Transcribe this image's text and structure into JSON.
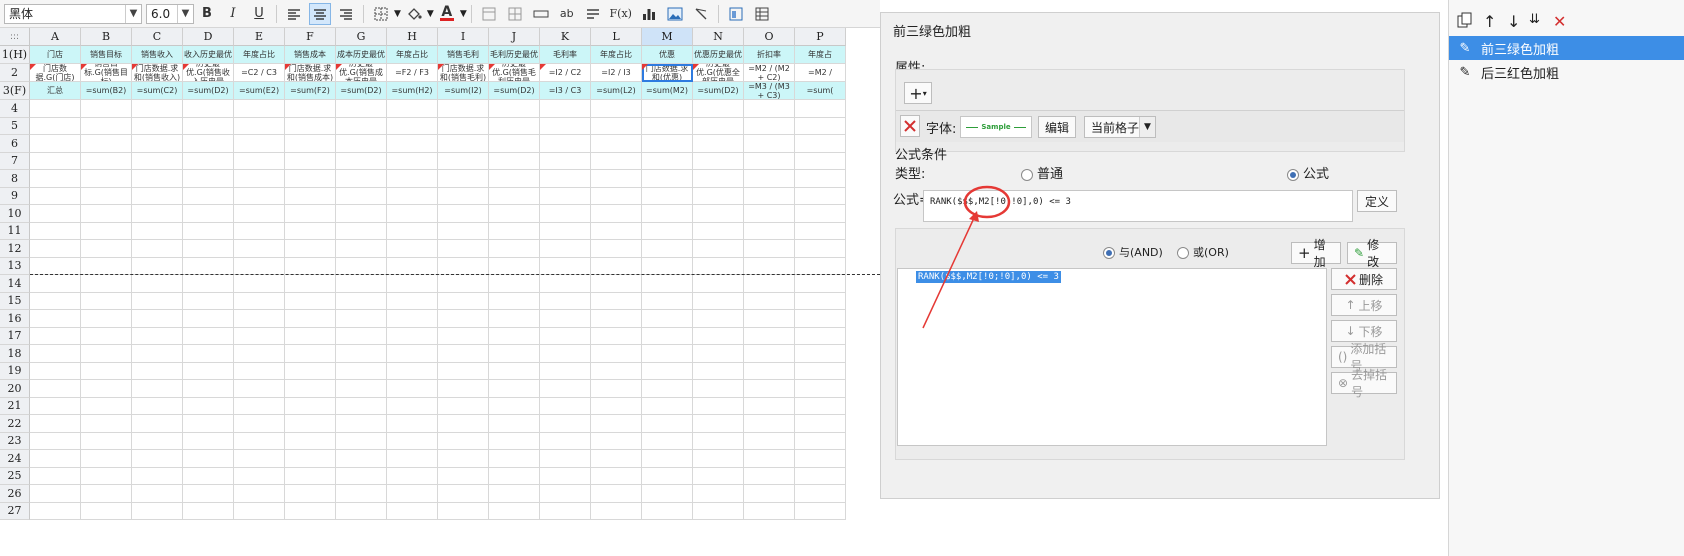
{
  "toolbar": {
    "font_name": "黑体",
    "font_size": "6.0",
    "bold": "B",
    "italic": "I",
    "underline": "U",
    "font_color_letter": "A",
    "fx": "F(x)",
    "ab": "ab"
  },
  "sheet": {
    "corner": ":::",
    "columns": [
      "A",
      "B",
      "C",
      "D",
      "E",
      "F",
      "G",
      "H",
      "I",
      "J",
      "K",
      "L",
      "M",
      "N",
      "O",
      "P"
    ],
    "selected_column": "M",
    "row_labels": [
      "1(H)",
      "2",
      "3(F)",
      "4",
      "5",
      "6",
      "7",
      "8",
      "9",
      "10",
      "11",
      "12",
      "13",
      "14",
      "15",
      "16",
      "17",
      "18",
      "19",
      "20",
      "21",
      "22",
      "23",
      "24",
      "25",
      "26",
      "27"
    ],
    "header_row": [
      "门店",
      "销售目标",
      "销售收入",
      "收入历史最优",
      "年度占比",
      "销售成本",
      "成本历史最优",
      "年度占比",
      "销售毛利",
      "毛利历史最优",
      "毛利率",
      "年度占比",
      "优惠",
      "优惠历史最优",
      "折扣率",
      "年度占"
    ],
    "data_row": [
      "门店数据.G(门店)",
      "销售目标.G(销售目标)",
      "门店数据.求和(销售收入)",
      "历史最优.G(销售收入历史最",
      "=C2 / C3",
      "门店数据.求和(销售成本)",
      "历史最优.G(销售成本历史最",
      "=F2 / F3",
      "门店数据.求和(销售毛利)",
      "历史最优.G(销售毛利历史最",
      "=I2 / C2",
      "=I2 / I3",
      "门店数据.求和(优惠)",
      "历史最优.G(优惠全部历史最",
      "=M2 / (M2 + C2)",
      "=M2 /"
    ],
    "total_row": [
      "汇总",
      "=sum(B2)",
      "=sum(C2)",
      "=sum(D2)",
      "=sum(E2)",
      "=sum(F2)",
      "=sum(D2)",
      "=sum(H2)",
      "=sum(I2)",
      "=sum(D2)",
      "=I3 / C3",
      "=sum(L2)",
      "=sum(M2)",
      "=sum(D2)",
      "=M3 / (M3 + C3)",
      "=sum("
    ]
  },
  "dialog": {
    "title": "前三绿色加粗",
    "properties_label": "属性:",
    "add_symbol": "+",
    "font_label": "字体:",
    "font_preview": "Sample",
    "edit_button": "编辑",
    "scope_select": "当前格子",
    "condition_label": "公式条件",
    "type_label": "类型:",
    "type_normal": "普通",
    "type_formula": "公式",
    "formula_label": "公式=",
    "formula_value": "RANK($$$,M2[!0;!0],0) <= 3",
    "define_button": "定义",
    "and_label": "与(AND)",
    "or_label": "或(OR)",
    "add_button": "增加",
    "modify_button": "修改",
    "condition_list": [
      "RANK($$$,M2[!0;!0],0) <= 3"
    ],
    "delete_button": "删除",
    "move_up_button": "上移",
    "move_down_button": "下移",
    "add_bracket_button": "添加括号",
    "remove_bracket_button": "去掉括号"
  },
  "right_panel": {
    "items": [
      "前三绿色加粗",
      "后三红色加粗"
    ],
    "selected_index": 0
  },
  "colors": {
    "header_fill": "#ccf6f8",
    "selection_blue": "#3d8ee6",
    "annotation_red": "#e53935",
    "preview_green": "#2e9e3a"
  }
}
